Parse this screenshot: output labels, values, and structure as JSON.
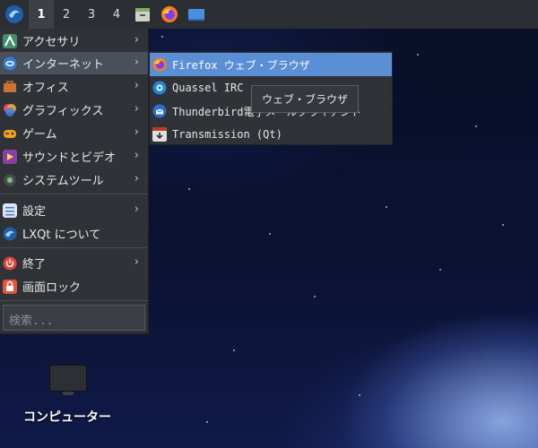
{
  "panel": {
    "workspaces": [
      "1",
      "2",
      "3",
      "4"
    ],
    "active_workspace": "1",
    "quicklaunch": [
      "file-manager-icon",
      "firefox-icon",
      "desktop-icon"
    ]
  },
  "menu": {
    "items": [
      {
        "label": "アクセサリ",
        "icon": "accessories-icon",
        "submenu": true
      },
      {
        "label": "インターネット",
        "icon": "internet-icon",
        "submenu": true
      },
      {
        "label": "オフィス",
        "icon": "office-icon",
        "submenu": true
      },
      {
        "label": "グラフィックス",
        "icon": "graphics-icon",
        "submenu": true
      },
      {
        "label": "ゲーム",
        "icon": "games-icon",
        "submenu": true
      },
      {
        "label": "サウンドとビデオ",
        "icon": "sound-video-icon",
        "submenu": true
      },
      {
        "label": "システムツール",
        "icon": "system-tools-icon",
        "submenu": true
      },
      {
        "label": "設定",
        "icon": "settings-icon",
        "submenu": true
      },
      {
        "label": "LXQt について",
        "icon": "lxqt-icon",
        "submenu": false
      },
      {
        "label": "終了",
        "icon": "power-icon",
        "submenu": true
      },
      {
        "label": "画面ロック",
        "icon": "lock-icon",
        "submenu": false
      }
    ],
    "arrow": "›",
    "search_placeholder": "検索..."
  },
  "submenu": {
    "items": [
      {
        "label": "Firefox ウェブ・ブラウザ",
        "icon": "firefox-icon"
      },
      {
        "label": "Quassel IRC",
        "icon": "quassel-icon"
      },
      {
        "label": "Thunderbird電子メールクライアント",
        "icon": "thunderbird-icon"
      },
      {
        "label": "Transmission (Qt)",
        "icon": "transmission-icon"
      }
    ]
  },
  "tooltip": "ウェブ・ブラウザ",
  "desktop": {
    "icons": [
      {
        "label": "コンピューター",
        "icon": "computer-icon"
      }
    ]
  },
  "colors": {
    "panel": "#2b2e33",
    "menu": "#2f3237",
    "highlight": "#4a505a",
    "selected": "#5a8fd6"
  }
}
